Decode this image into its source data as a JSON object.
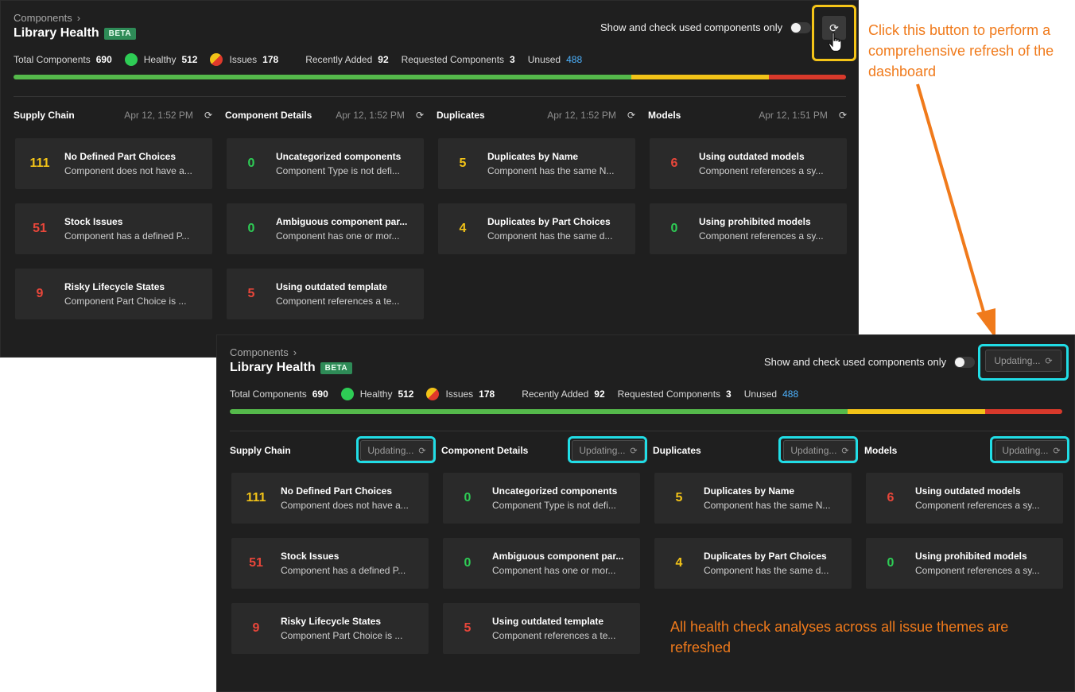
{
  "header": {
    "breadcrumb": "Components",
    "title": "Library Health",
    "badge": "BETA",
    "toggle_label": "Show and check used components only",
    "updating_label": "Updating..."
  },
  "stats": {
    "total_label": "Total Components",
    "total": "690",
    "healthy_label": "Healthy",
    "healthy": "512",
    "issues_label": "Issues",
    "issues": "178",
    "recent_label": "Recently Added",
    "recent": "92",
    "requested_label": "Requested Components",
    "requested": "3",
    "unused_label": "Unused",
    "unused": "488"
  },
  "health_bar": {
    "healthy_fraction": 0.742,
    "warn_fraction": 0.165,
    "error_fraction": 0.093
  },
  "sections": [
    {
      "title": "Supply Chain",
      "timestamp": "Apr 12, 1:52 PM"
    },
    {
      "title": "Component Details",
      "timestamp": "Apr 12, 1:52 PM"
    },
    {
      "title": "Duplicates",
      "timestamp": "Apr 12, 1:52 PM"
    },
    {
      "title": "Models",
      "timestamp": "Apr 12, 1:51 PM"
    }
  ],
  "cards": {
    "supply": [
      {
        "count": "111",
        "title": "No Defined Part Choices",
        "desc": "Component does not have a..."
      },
      {
        "count": "51",
        "title": "Stock Issues",
        "desc": "Component has a defined P..."
      },
      {
        "count": "9",
        "title": "Risky Lifecycle States",
        "desc": "Component Part Choice is ..."
      }
    ],
    "details": [
      {
        "count": "0",
        "title": "Uncategorized components",
        "desc": "Component Type is not defi..."
      },
      {
        "count": "0",
        "title": "Ambiguous component par...",
        "desc": "Component has one or mor..."
      },
      {
        "count": "5",
        "title": "Using outdated template",
        "desc": "Component references a te..."
      }
    ],
    "duplicates": [
      {
        "count": "5",
        "title": "Duplicates by Name",
        "desc": "Component has the same N..."
      },
      {
        "count": "4",
        "title": "Duplicates by Part Choices",
        "desc": "Component has the same d..."
      }
    ],
    "models": [
      {
        "count": "6",
        "title": "Using outdated models",
        "desc": "Component references a sy..."
      },
      {
        "count": "0",
        "title": "Using prohibited models",
        "desc": "Component references a sy..."
      }
    ]
  },
  "annotations": {
    "top": "Click this button to perform a comprehensive refresh of the dashboard",
    "bottom": "All health check analyses across all issue themes are refreshed"
  },
  "colors": {
    "healthy": "#2ecc55",
    "warning": "#f2c318",
    "error": "#e8463a",
    "highlight_yellow": "#f5c518",
    "highlight_cyan": "#21dde6",
    "annotation": "#f07a1b"
  },
  "icons": {
    "refresh": "refresh-icon",
    "chevron": "chevron-right-icon",
    "cursor": "hand-cursor-icon"
  }
}
